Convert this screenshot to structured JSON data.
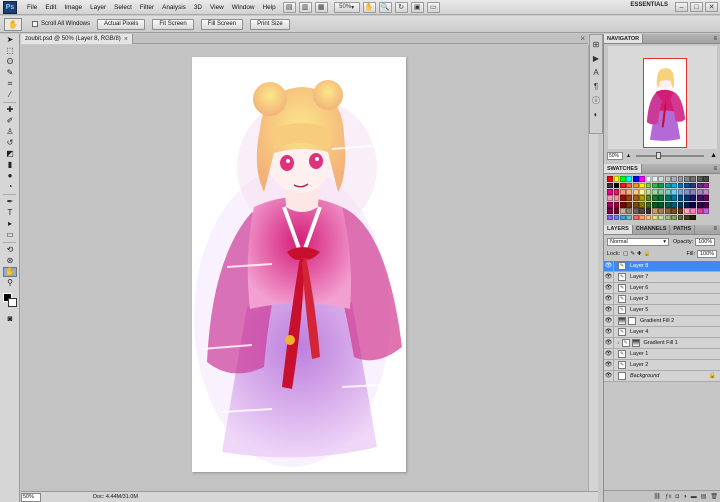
{
  "menubar": {
    "logo": "Ps",
    "items": [
      "File",
      "Edit",
      "Image",
      "Layer",
      "Select",
      "Filter",
      "Analysis",
      "3D",
      "View",
      "Window",
      "Help"
    ],
    "zoom": "50%",
    "workspace": "ESSENTIALS",
    "window_buttons": [
      "–",
      "□",
      "✕"
    ]
  },
  "options": {
    "scroll_all": "Scroll All Windows",
    "buttons": [
      "Actual Pixels",
      "Fit Screen",
      "Fill Screen",
      "Print Size"
    ]
  },
  "document": {
    "tab_title": "zoubit.psd @ 50% (Layer 8, RGB/8)",
    "zoom": "50%",
    "info": "Doc: 4.44M/31.0M"
  },
  "navigator": {
    "title": "NAVIGATOR",
    "zoom": "50%"
  },
  "swatches": {
    "title": "SWATCHES",
    "colors": [
      "#ff0000",
      "#ffff00",
      "#00ff00",
      "#00ffff",
      "#0000ff",
      "#ff00ff",
      "#ffffff",
      "#ebebeb",
      "#d6d6d6",
      "#c2c2c2",
      "#adadad",
      "#999999",
      "#858585",
      "#707070",
      "#5c5c5c",
      "#474747",
      "#333333",
      "#000000",
      "#ed1c24",
      "#f26522",
      "#f7941d",
      "#fff200",
      "#8dc63f",
      "#39b54a",
      "#00a651",
      "#00a99d",
      "#00aeef",
      "#0072bc",
      "#0054a6",
      "#2e3192",
      "#662d91",
      "#92278f",
      "#ec008c",
      "#ed145b",
      "#f69679",
      "#f9ad81",
      "#fdc689",
      "#fff799",
      "#c4df9b",
      "#a3d39c",
      "#82ca9c",
      "#7accc8",
      "#6dcff6",
      "#7da7d9",
      "#8393ca",
      "#8781bd",
      "#a186be",
      "#bd8cbf",
      "#f49ac1",
      "#f5989d",
      "#9e0b0f",
      "#a0410d",
      "#a36209",
      "#aba000",
      "#598527",
      "#1a7b30",
      "#007236",
      "#00746b",
      "#0076a3",
      "#004b80",
      "#003471",
      "#1b1464",
      "#440e62",
      "#630460",
      "#9e005d",
      "#9e0039",
      "#790000",
      "#7b2e00",
      "#7d4900",
      "#827b00",
      "#406618",
      "#005e20",
      "#005826",
      "#005952",
      "#005b7f",
      "#003663",
      "#002157",
      "#0d004c",
      "#32004b",
      "#4b0049",
      "#7b0046",
      "#7a0026",
      "#c7b299",
      "#998675",
      "#736357",
      "#534741",
      "#37302a",
      "#c69c6d",
      "#a67c52",
      "#8c6239",
      "#754c24",
      "#603913",
      "#ffa8c0",
      "#ff80c0",
      "#e040a0",
      "#c060e0",
      "#8060ff",
      "#6080ff",
      "#40a0e0",
      "#60c0c0",
      "#ff6060",
      "#ffa060",
      "#ffc080",
      "#e0e080",
      "#c0e0a0",
      "#a0c080",
      "#80a060",
      "#606040",
      "#404020",
      "#202000"
    ]
  },
  "layers": {
    "tabs": [
      "LAYERS",
      "CHANNELS",
      "PATHS"
    ],
    "blend_mode": "Normal",
    "opacity_label": "Opacity:",
    "opacity": "100%",
    "lock_label": "Lock:",
    "fill_label": "Fill:",
    "fill": "100%",
    "items": [
      {
        "name": "Layer 8",
        "selected": true
      },
      {
        "name": "Layer 7"
      },
      {
        "name": "Layer 6"
      },
      {
        "name": "Layer 3"
      },
      {
        "name": "Layer 5"
      },
      {
        "name": "Gradient Fill 2"
      },
      {
        "name": "Layer 4"
      },
      {
        "name": "Gradient Fill 1"
      },
      {
        "name": "Layer 1"
      },
      {
        "name": "Layer 2"
      },
      {
        "name": "Background"
      }
    ]
  }
}
